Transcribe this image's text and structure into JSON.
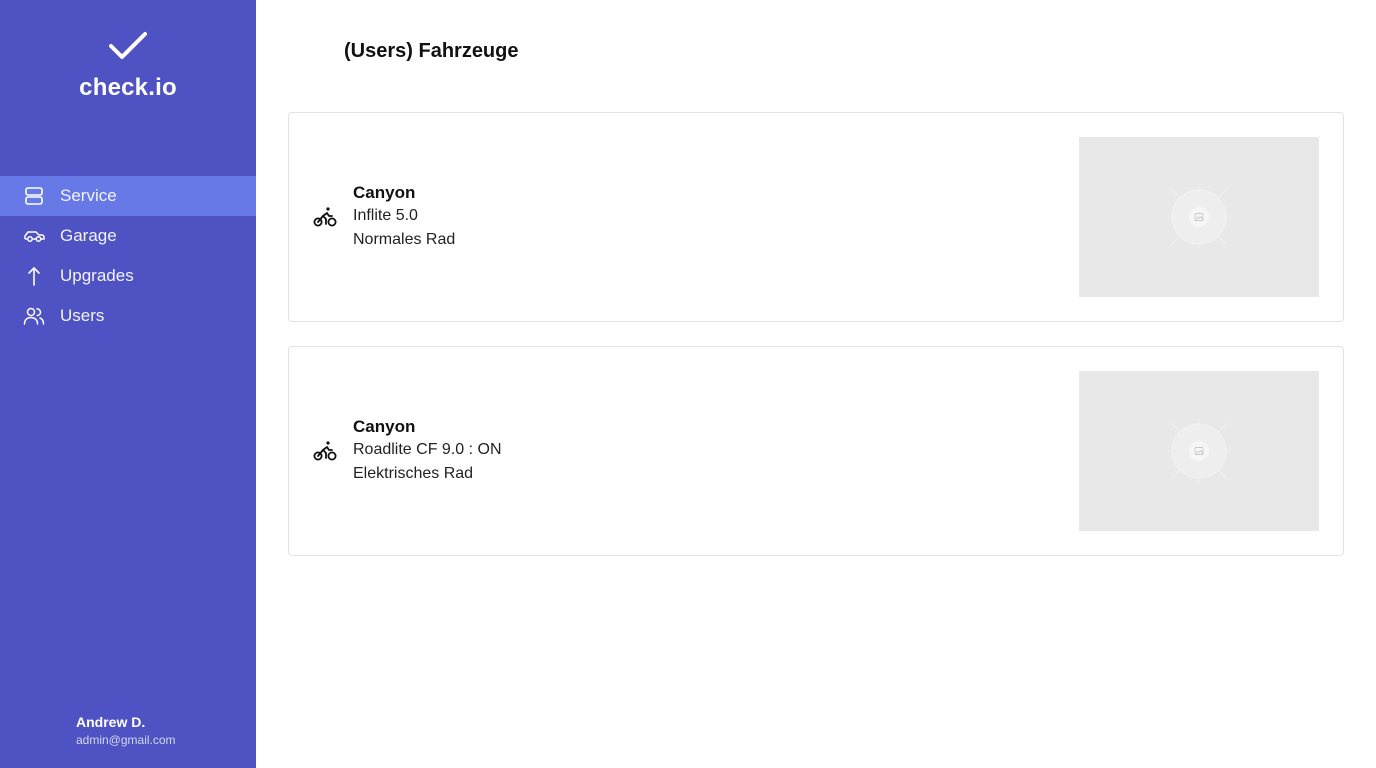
{
  "sidebar": {
    "app_name": "check.io",
    "items": [
      {
        "label": "Service",
        "icon": "server-icon",
        "active": true
      },
      {
        "label": "Garage",
        "icon": "car-icon",
        "active": false
      },
      {
        "label": "Upgrades",
        "icon": "arrow-up-icon",
        "active": false
      },
      {
        "label": "Users",
        "icon": "users-icon",
        "active": false
      }
    ],
    "user": {
      "name": "Andrew D.",
      "email": "admin@gmail.com"
    }
  },
  "main": {
    "title": "(Users) Fahrzeuge",
    "vehicles": [
      {
        "brand": "Canyon",
        "model": "Inflite 5.0",
        "type": "Normales Rad",
        "icon": "bicycle-icon",
        "image": "image-placeholder"
      },
      {
        "brand": "Canyon",
        "model": "Roadlite CF 9.0 : ON",
        "type": "Elektrisches Rad",
        "icon": "bicycle-icon",
        "image": "image-placeholder"
      }
    ]
  },
  "colors": {
    "sidebar_bg": "#4f52c2",
    "active_item_bg": "#6779e7",
    "image_placeholder_bg": "#e8e8e8"
  }
}
